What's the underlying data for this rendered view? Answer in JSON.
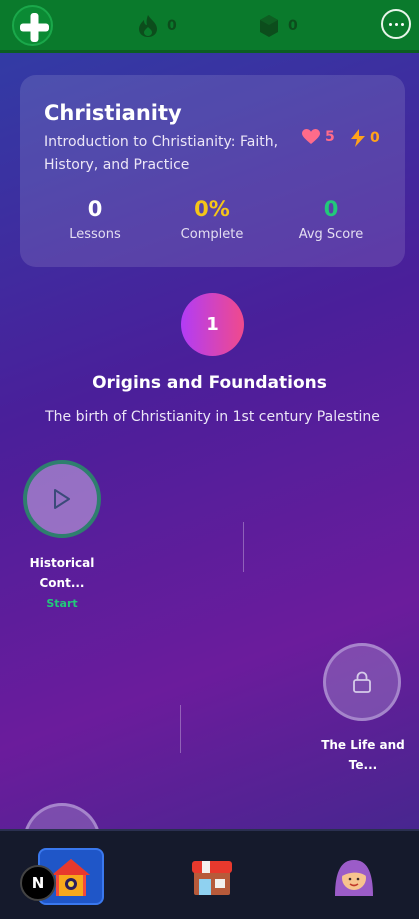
{
  "topbar": {
    "logo_icon": "plus-circle-icon",
    "streak_icon": "flame-icon",
    "streak_count": "0",
    "gems_icon": "gem-icon",
    "gems_count": "0",
    "more_icon": "more-horizontal-icon"
  },
  "course": {
    "title": "Christianity",
    "subtitle": "Introduction to Christianity: Faith, History, and Practice",
    "hearts": "5",
    "energy": "0",
    "metrics": [
      {
        "value": "0",
        "label": "Lessons",
        "color": "#ffffff"
      },
      {
        "value": "0%",
        "label": "Complete",
        "color": "#f5c518"
      },
      {
        "value": "0",
        "label": "Avg Score",
        "color": "#22c97a"
      }
    ]
  },
  "unit": {
    "number": "1",
    "title": "Origins and Foundations",
    "description": "The birth of Christianity in 1st century Palestine"
  },
  "lessons": [
    {
      "label_line1": "Historical",
      "label_line2": "Cont...",
      "status": "Start",
      "icon": "play-icon"
    },
    {
      "label_line1": "The Life and",
      "label_line2": "Te...",
      "status": "",
      "icon": "lock-icon"
    }
  ],
  "bottomnav": {
    "items": [
      {
        "name": "home",
        "icon": "home-icon",
        "active": true
      },
      {
        "name": "shop",
        "icon": "shop-icon",
        "active": false
      },
      {
        "name": "profile",
        "icon": "avatar-icon",
        "active": false
      }
    ],
    "dev_badge": "N"
  },
  "colors": {
    "topbar": "#0a7a2c",
    "hearts": "#ff6b8a",
    "energy": "#ffa21a",
    "accent_green": "#22c97a",
    "accent_yellow": "#f5c518"
  }
}
